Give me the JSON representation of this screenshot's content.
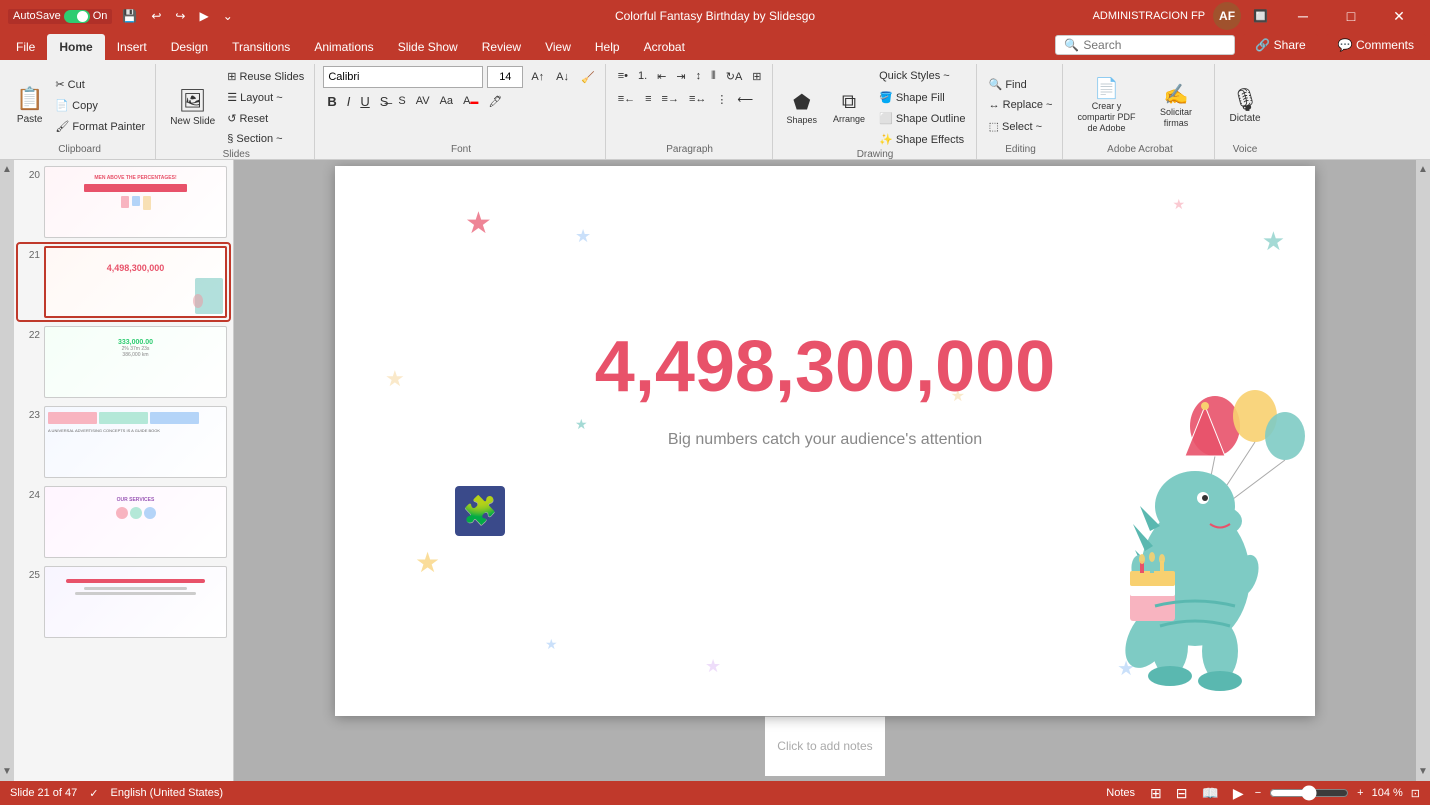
{
  "titlebar": {
    "autosave_label": "AutoSave",
    "autosave_state": "On",
    "title": "Colorful Fantasy Birthday by Slidesgo",
    "user_initials": "AF",
    "app_name": "ADMINISTRACION FP"
  },
  "ribbon_tabs": [
    {
      "label": "File",
      "active": false
    },
    {
      "label": "Home",
      "active": true
    },
    {
      "label": "Insert",
      "active": false
    },
    {
      "label": "Design",
      "active": false
    },
    {
      "label": "Transitions",
      "active": false
    },
    {
      "label": "Animations",
      "active": false
    },
    {
      "label": "Slide Show",
      "active": false
    },
    {
      "label": "Review",
      "active": false
    },
    {
      "label": "View",
      "active": false
    },
    {
      "label": "Help",
      "active": false
    },
    {
      "label": "Acrobat",
      "active": false
    }
  ],
  "ribbon": {
    "search_placeholder": "Search",
    "clipboard_group": "Clipboard",
    "slides_group": "Slides",
    "font_group": "Font",
    "paragraph_group": "Paragraph",
    "drawing_group": "Drawing",
    "editing_group": "Editing",
    "adobe_group": "Adobe Acrobat",
    "voice_group": "Voice",
    "paste_label": "Paste",
    "new_slide_label": "New Slide",
    "reuse_slides_label": "Reuse Slides",
    "layout_label": "Layout ~",
    "reset_label": "Reset",
    "section_label": "Section ~",
    "shapes_label": "Shapes",
    "arrange_label": "Arrange",
    "quick_styles_label": "Quick Styles ~",
    "shape_effects_label": "Shape Effects",
    "shape_fill_label": "Shape Fill",
    "shape_outline_label": "Shape Outline",
    "find_label": "Find",
    "replace_label": "Replace ~",
    "select_label": "Select ~",
    "font_name": "Calibri",
    "font_size": "14",
    "bold_label": "B",
    "italic_label": "I",
    "underline_label": "U",
    "adobe_create_label": "Crear y compartir PDF de Adobe",
    "solicitar_label": "Solicitar firmas",
    "dictate_label": "Dictate"
  },
  "slides": [
    {
      "num": "20",
      "active": false
    },
    {
      "num": "21",
      "active": true
    },
    {
      "num": "22",
      "active": false
    },
    {
      "num": "23",
      "active": false
    },
    {
      "num": "24",
      "active": false
    },
    {
      "num": "25",
      "active": false
    }
  ],
  "current_slide": {
    "big_number": "4,498,300,000",
    "subtitle": "Big numbers catch your audience's attention"
  },
  "notes_placeholder": "Click to add notes",
  "statusbar": {
    "slide_info": "Slide 21 of 47",
    "language": "English (United States)",
    "accessibility": "✓",
    "notes_label": "Notes",
    "zoom_level": "104 %"
  }
}
